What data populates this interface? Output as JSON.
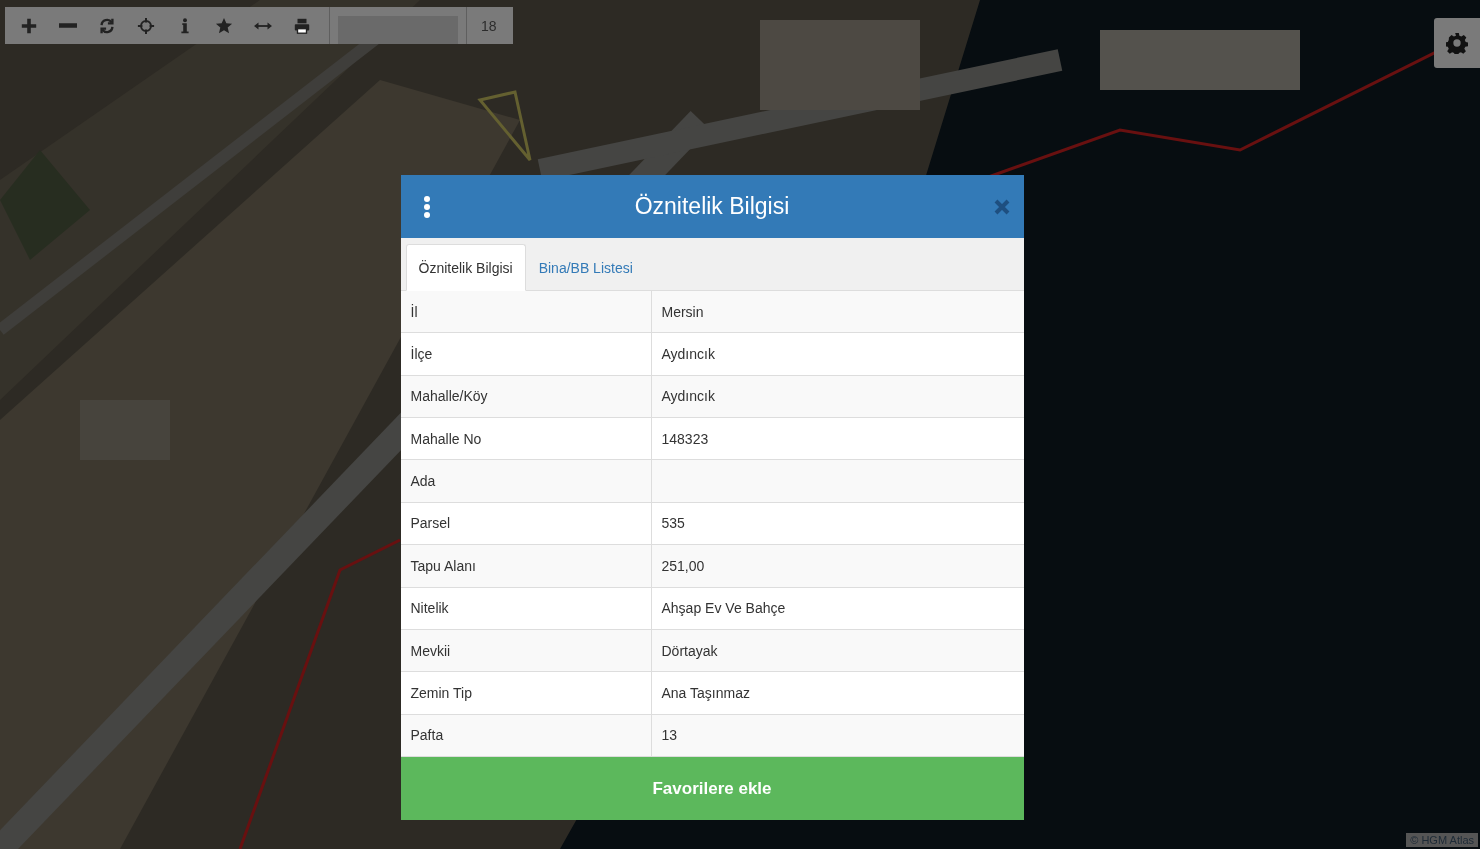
{
  "toolbar": {
    "buttons": [
      {
        "kind": "plus"
      },
      {
        "kind": "minus"
      },
      {
        "kind": "refresh"
      },
      {
        "kind": "locate"
      },
      {
        "kind": "info"
      },
      {
        "kind": "star"
      },
      {
        "kind": "measure"
      },
      {
        "kind": "print"
      }
    ],
    "zoom_level": "18"
  },
  "attribution": "© HGM Atlas",
  "dialog": {
    "title": "Öznitelik Bilgisi",
    "tabs": [
      {
        "label": "Öznitelik Bilgisi",
        "selected": true
      },
      {
        "label": "Bina/BB Listesi",
        "selected": false
      }
    ],
    "rows": [
      {
        "label": "İl",
        "value": "Mersin"
      },
      {
        "label": "İlçe",
        "value": "Aydıncık"
      },
      {
        "label": "Mahalle/Köy",
        "value": "Aydıncık"
      },
      {
        "label": "Mahalle No",
        "value": "148323"
      },
      {
        "label": "Ada",
        "value": ""
      },
      {
        "label": "Parsel",
        "value": "535"
      },
      {
        "label": "Tapu Alanı",
        "value": "251,00"
      },
      {
        "label": "Nitelik",
        "value": "Ahşap Ev Ve Bahçe"
      },
      {
        "label": "Mevkii",
        "value": "Dörtayak"
      },
      {
        "label": "Zemin Tip",
        "value": "Ana Taşınmaz"
      },
      {
        "label": "Pafta",
        "value": "13"
      }
    ],
    "button": "Favorilere ekle"
  }
}
